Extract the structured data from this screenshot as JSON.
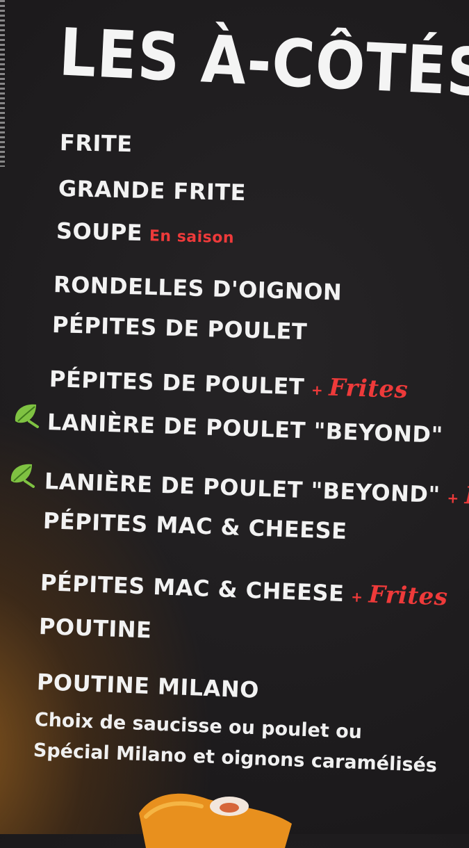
{
  "title": "LES À-CÔTÉS",
  "items": [
    {
      "label": "FRITE"
    },
    {
      "label": "GRANDE FRITE"
    },
    {
      "label": "SOUPE",
      "note": "En saison"
    },
    {
      "label": "RONDELLES D'OIGNON"
    },
    {
      "label": "PÉPITES DE POULET"
    },
    {
      "label": "PÉPITES DE POULET",
      "plus": "+",
      "extra": "Frites"
    },
    {
      "label": "LANIÈRE DE POULET \"BEYOND\"",
      "icon": "leaf-icon"
    },
    {
      "label": "LANIÈRE DE POULET \"BEYOND\"",
      "icon": "leaf-icon",
      "plus": "+",
      "extra": "F"
    },
    {
      "label": "PÉPITES MAC & CHEESE"
    },
    {
      "label": "PÉPITES MAC & CHEESE",
      "plus": "+",
      "extra": "Frites"
    },
    {
      "label": "POUTINE"
    },
    {
      "label": "POUTINE MILANO"
    }
  ],
  "description": {
    "line1": "Choix de saucisse ou poulet ou",
    "line2": "Spécial Milano et oignons caramélisés"
  },
  "colors": {
    "text": "#f2f2f2",
    "accent": "#ee3a3a",
    "leaf": "#7fc242",
    "background": "#1c1a1c"
  }
}
